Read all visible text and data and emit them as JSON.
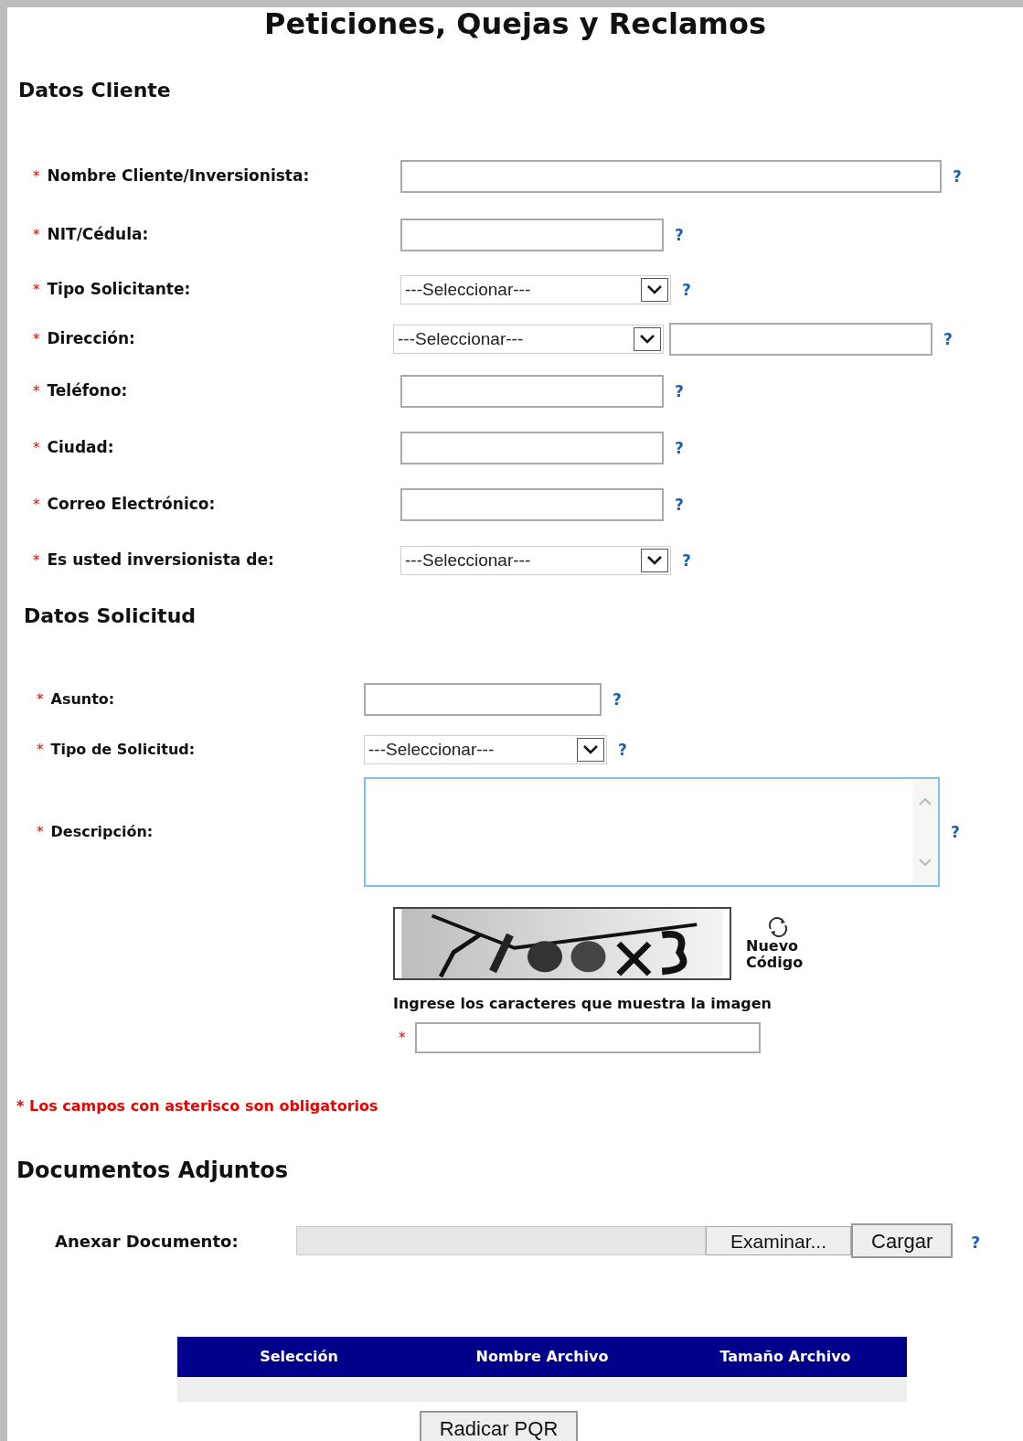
{
  "title": "Peticiones, Quejas y Reclamos",
  "client_section": {
    "heading": "Datos Cliente",
    "fields": [
      {
        "kind": "wide_text",
        "label": "Nombre Cliente/Inversionista:",
        "required": "*",
        "help": "?"
      },
      {
        "kind": "text",
        "label": "NIT/Cédula:",
        "required": "*",
        "help": "?"
      },
      {
        "kind": "select",
        "label": "Tipo Solicitante:",
        "required": "*",
        "help": "?",
        "value": "---Seleccionar---"
      },
      {
        "kind": "select_text",
        "label": "Dirección:",
        "required": "*",
        "help": "?",
        "value": "---Seleccionar---"
      },
      {
        "kind": "text",
        "label": "Teléfono:",
        "required": "*",
        "help": "?"
      },
      {
        "kind": "text",
        "label": "Ciudad:",
        "required": "*",
        "help": "?"
      },
      {
        "kind": "text",
        "label": "Correo Electrónico:",
        "required": "*",
        "help": "?"
      },
      {
        "kind": "select",
        "label": "Es usted inversionista de:",
        "required": "*",
        "help": "?",
        "value": "---Seleccionar---"
      }
    ]
  },
  "request_section": {
    "heading": "Datos Solicitud",
    "fields": [
      {
        "kind": "text",
        "label": "Asunto:",
        "required": "*",
        "help": "?"
      },
      {
        "kind": "select",
        "label": "Tipo de Solicitud:",
        "required": "*",
        "help": "?",
        "value": "---Seleccionar---"
      },
      {
        "kind": "textarea",
        "label": "Descripción:",
        "required": "*",
        "help": "?"
      }
    ]
  },
  "captcha": {
    "refresh_label": "Nuevo Código",
    "instruction": "Ingrese los caracteres que muestra la imagen",
    "required": "*"
  },
  "required_note": "* Los campos con asterisco son obligatorios",
  "attachments": {
    "heading": "Documentos Adjuntos",
    "label": "Anexar Documento:",
    "browse_button": "Examinar...",
    "upload_button": "Cargar",
    "help": "?",
    "columns": [
      "Selección",
      "Nombre Archivo",
      "Tamaño Archivo"
    ]
  },
  "submit_button": "Radicar PQR"
}
